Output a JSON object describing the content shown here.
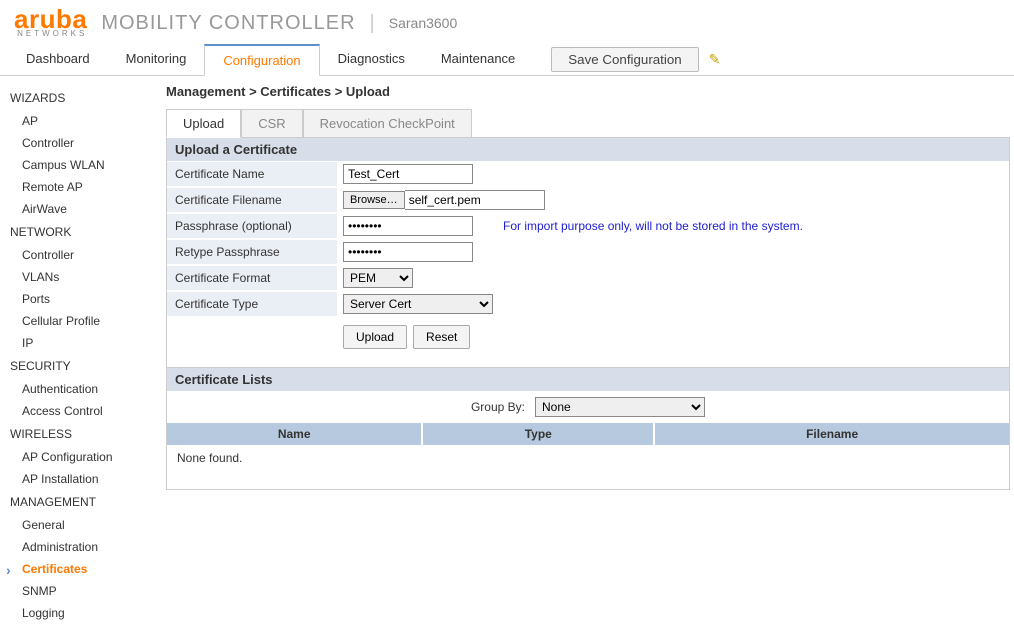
{
  "brand": {
    "name": "aruba",
    "sub": "NETWORKS",
    "product": "MOBILITY CONTROLLER",
    "hostname": "Saran3600"
  },
  "topnav": {
    "tabs": [
      "Dashboard",
      "Monitoring",
      "Configuration",
      "Diagnostics",
      "Maintenance"
    ],
    "active": "Configuration",
    "save": "Save Configuration"
  },
  "sidebar": [
    {
      "group": "WIZARDS",
      "items": [
        "AP",
        "Controller",
        "Campus WLAN",
        "Remote AP",
        "AirWave"
      ]
    },
    {
      "group": "NETWORK",
      "items": [
        "Controller",
        "VLANs",
        "Ports",
        "Cellular Profile",
        "IP"
      ]
    },
    {
      "group": "SECURITY",
      "items": [
        "Authentication",
        "Access Control"
      ]
    },
    {
      "group": "WIRELESS",
      "items": [
        "AP Configuration",
        "AP Installation"
      ]
    },
    {
      "group": "MANAGEMENT",
      "items": [
        "General",
        "Administration",
        "Certificates",
        "SNMP",
        "Logging"
      ]
    }
  ],
  "active_item": "Certificates",
  "breadcrumb": "Management > Certificates > Upload",
  "subtabs": {
    "items": [
      "Upload",
      "CSR",
      "Revocation CheckPoint"
    ],
    "active": "Upload"
  },
  "form": {
    "section": "Upload a Certificate",
    "rows": {
      "cert_name": {
        "label": "Certificate Name",
        "value": "Test_Cert"
      },
      "cert_file": {
        "label": "Certificate Filename",
        "browse": "Browse…",
        "filename": "self_cert.pem"
      },
      "pass": {
        "label": "Passphrase (optional)",
        "value": "••••••••",
        "hint": "For import purpose only, will not be stored in the system."
      },
      "repass": {
        "label": "Retype Passphrase",
        "value": "••••••••"
      },
      "format": {
        "label": "Certificate Format",
        "value": "PEM"
      },
      "type": {
        "label": "Certificate Type",
        "value": "Server Cert"
      }
    },
    "buttons": {
      "upload": "Upload",
      "reset": "Reset"
    }
  },
  "list": {
    "section": "Certificate Lists",
    "groupby_label": "Group By:",
    "groupby_value": "None",
    "columns": [
      "Name",
      "Type",
      "Filename"
    ],
    "empty": "None found."
  }
}
